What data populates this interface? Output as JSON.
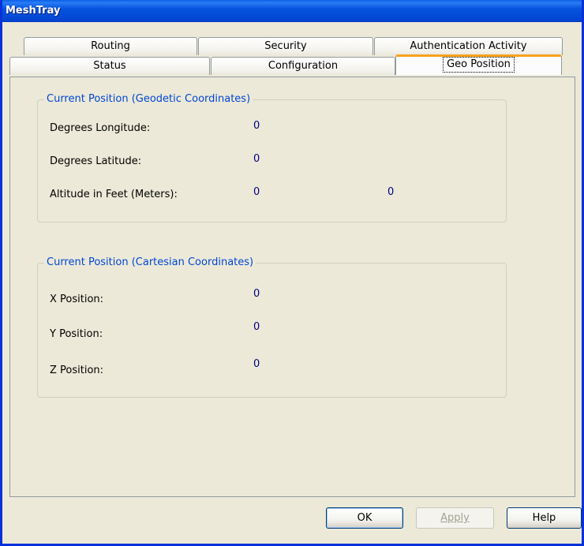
{
  "window": {
    "title": "MeshTray"
  },
  "tabs": {
    "row1": [
      {
        "label": "Routing"
      },
      {
        "label": "Security"
      },
      {
        "label": "Authentication Activity"
      }
    ],
    "row2": [
      {
        "label": "Status"
      },
      {
        "label": "Configuration"
      },
      {
        "label": "Geo Position",
        "active": true
      }
    ]
  },
  "geodetic": {
    "legend": "Current Position (Geodetic Coordinates)",
    "longitude_label": "Degrees Longitude:",
    "longitude_value": "0",
    "latitude_label": "Degrees Latitude:",
    "latitude_value": "0",
    "altitude_label": "Altitude in Feet (Meters):",
    "altitude_feet": "0",
    "altitude_meters": "0"
  },
  "cartesian": {
    "legend": "Current Position (Cartesian Coordinates)",
    "x_label": "X Position:",
    "x_value": "0",
    "y_label": "Y Position:",
    "y_value": "0",
    "z_label": "Z Position:",
    "z_value": "0"
  },
  "buttons": {
    "ok": "OK",
    "apply": "Apply",
    "help": "Help"
  },
  "colors": {
    "titlebar": "#0553de",
    "group_legend": "#0046d5",
    "value_text": "#000080",
    "active_tab_accent": "#f7a21c"
  }
}
